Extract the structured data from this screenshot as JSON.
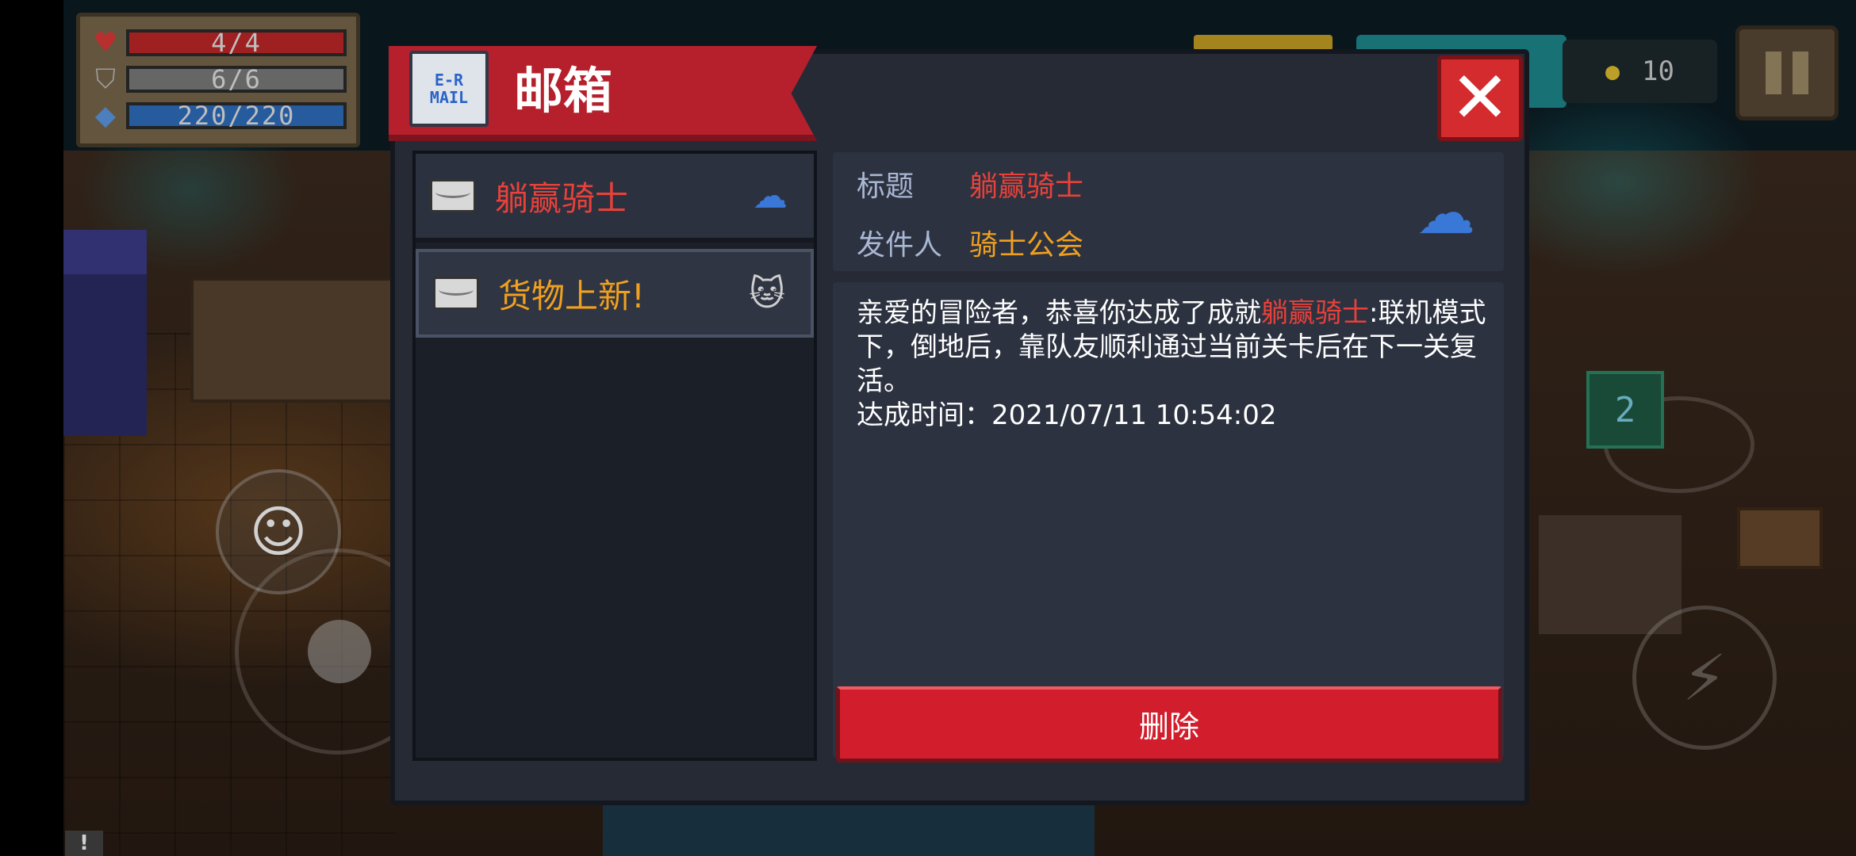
{
  "hud": {
    "hp": "4/4",
    "armor": "6/6",
    "energy": "220/220",
    "gold": "10",
    "icons": {
      "hp": "heart-icon",
      "armor": "shield-icon",
      "energy": "diamond-icon",
      "gold": "coin-icon",
      "pause": "pause-icon"
    },
    "weapon_level": "2"
  },
  "mailbox": {
    "title": "邮箱",
    "header_icon_text": "E-R\nMAIL",
    "close_label": "✕",
    "items": [
      {
        "subject": "躺赢骑士",
        "color": "#e8413a"
      },
      {
        "subject": "货物上新!",
        "color": "#f0a020"
      }
    ],
    "detail": {
      "title_label": "标题",
      "title_value": "躺赢骑士",
      "sender_label": "发件人",
      "sender_value": "骑士公会",
      "message_prefix": "亲爱的冒险者，恭喜你达成了成就",
      "message_highlight": "躺赢骑士",
      "message_suffix": ":联机模式下，倒地后，靠队友顺利通过当前关卡后在下一关复活。",
      "time_line": "达成时间：2021/07/11 10:54:02"
    },
    "delete_label": "删除"
  },
  "colors": {
    "accent_red": "#d21e2c",
    "highlight_red": "#e8413a",
    "sender_orange": "#f0a020",
    "panel_dark": "#252a35"
  }
}
